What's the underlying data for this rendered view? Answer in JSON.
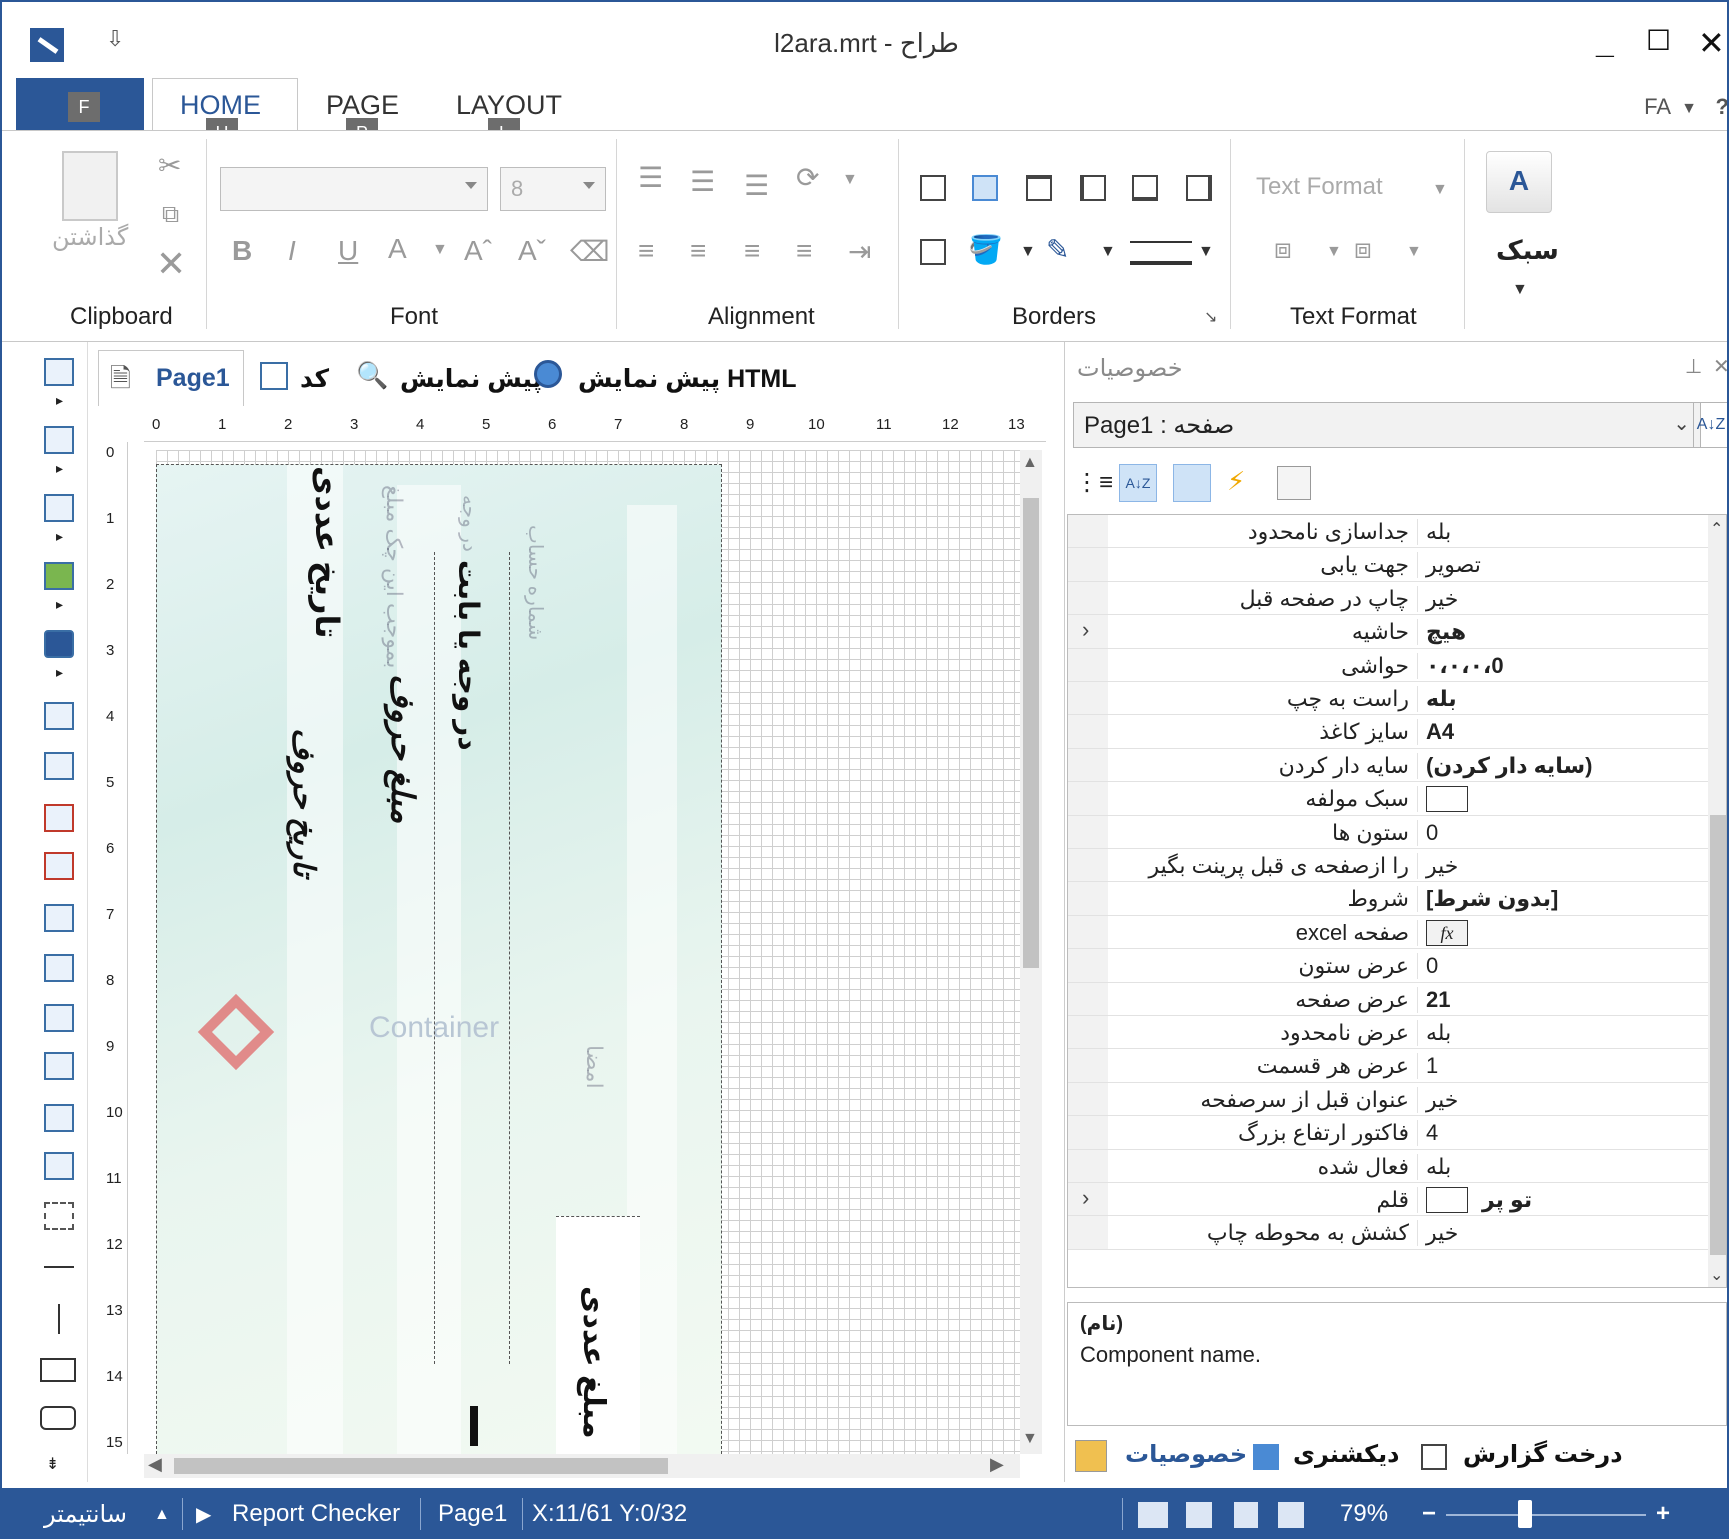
{
  "window": {
    "title": "l2ara.mrt - طراح",
    "minimize": "_",
    "maximize": "☐",
    "close": "✕",
    "quick_access": "⇩"
  },
  "ribbon": {
    "tabs": {
      "file_keytip": "F",
      "home": "HOME",
      "home_keytip": "H",
      "page": "PAGE",
      "page_keytip": "P",
      "layout": "LAYOUT",
      "layout_keytip": "L"
    },
    "language": "FA",
    "help": "?",
    "clipboard": {
      "paste_label": "گذاشتن",
      "group_label": "Clipboard"
    },
    "font": {
      "size_value": "8",
      "group_label": "Font",
      "bold": "B",
      "italic": "I",
      "underline": "U",
      "color": "A"
    },
    "alignment": {
      "group_label": "Alignment"
    },
    "borders": {
      "group_label": "Borders"
    },
    "text_format": {
      "combo_value": "Text Format",
      "group_label": "Text Format"
    },
    "style": {
      "label": "سبک",
      "icon_text": "A"
    }
  },
  "doc_tabs": {
    "page1": "Page1",
    "code": "کد",
    "preview": "پیش نمایش",
    "html_preview": "پیش نمایش HTML"
  },
  "ruler": {
    "h": [
      "0",
      "1",
      "2",
      "3",
      "4",
      "5",
      "6",
      "7",
      "8",
      "9",
      "10",
      "11",
      "12",
      "13"
    ],
    "v": [
      "0",
      "1",
      "2",
      "3",
      "4",
      "5",
      "6",
      "7",
      "8",
      "9",
      "10",
      "11",
      "12",
      "13",
      "14",
      "15"
    ]
  },
  "canvas": {
    "date_numeric": "تاریخ عددی",
    "date_letters": "تاریخ حروف",
    "amount_letters": "مبلغ حروف",
    "to_order": "در وجه یا بابت",
    "amount_numeric": "مبلغ عددی",
    "container": "Container",
    "faint_1": "بموجب این چک مبلغ",
    "faint_2": "در وجه",
    "faint_3": "شماره حساب",
    "signature": "امضا"
  },
  "properties": {
    "title": "خصوصیات",
    "object": "Page1 : صفحه",
    "sort_icon_text": "A↓Z",
    "rows": [
      {
        "name": "جداسازی نامحدود",
        "value": "بله",
        "bold": false
      },
      {
        "name": "جهت یابی",
        "value": "تصویر",
        "bold": false
      },
      {
        "name": "چاپ در صفحه قبل",
        "value": "خیر",
        "bold": false
      },
      {
        "name": "حاشیه",
        "value": "هیچ",
        "bold": true,
        "expand": "›"
      },
      {
        "name": "حواشی",
        "value": "۰،۰،۰،0",
        "bold": true
      },
      {
        "name": "راست به چپ",
        "value": "بله",
        "bold": true
      },
      {
        "name": "سایز کاغذ",
        "value": "A4",
        "bold": true
      },
      {
        "name": "سایه دار کردن",
        "value": "(سایه دار کردن)",
        "bold": true
      },
      {
        "name": "سبک مولفه",
        "value": "",
        "box": true
      },
      {
        "name": "ستون ها",
        "value": "0",
        "bold": false
      },
      {
        "name": "را ازصفحه ی قبل پرینت بگیر",
        "value": "خیر",
        "bold": false
      },
      {
        "name": "شروط",
        "value": "[بدون شرط]",
        "bold": true
      },
      {
        "name": "صفحه excel",
        "value": "fx",
        "box": true
      },
      {
        "name": "عرض ستون",
        "value": "0",
        "bold": false
      },
      {
        "name": "عرض صفحه",
        "value": "21",
        "bold": true
      },
      {
        "name": "عرض نامحدود",
        "value": "بله",
        "bold": false
      },
      {
        "name": "عرض هر قسمت",
        "value": "1",
        "bold": false
      },
      {
        "name": "عنوان قبل از سرصفحه",
        "value": "خیر",
        "bold": false
      },
      {
        "name": "فاکتور ارتفاع بزرگ",
        "value": "4",
        "bold": false
      },
      {
        "name": "فعال شده",
        "value": "بله",
        "bold": false
      },
      {
        "name": "قلم",
        "value": "تو پر",
        "bold": true,
        "expand": "›",
        "box": true
      },
      {
        "name": "کشش به محوطه چاپ",
        "value": "خیر",
        "bold": false
      }
    ],
    "desc_title": "(نام)",
    "desc_text": "Component name.",
    "bottom_tabs": {
      "properties": "خصوصیات",
      "dictionary": "دیکشنری",
      "report_tree": "درخت گزارش"
    }
  },
  "status": {
    "units": "سانتیمتر",
    "report_checker": "Report Checker",
    "page": "Page1",
    "coords": "X:11/61  Y:0/32",
    "zoom": "79%",
    "zoom_minus": "−",
    "zoom_plus": "+"
  },
  "colors": {
    "accent": "#2b5797",
    "cheque_bg": "#e6f4f3"
  }
}
